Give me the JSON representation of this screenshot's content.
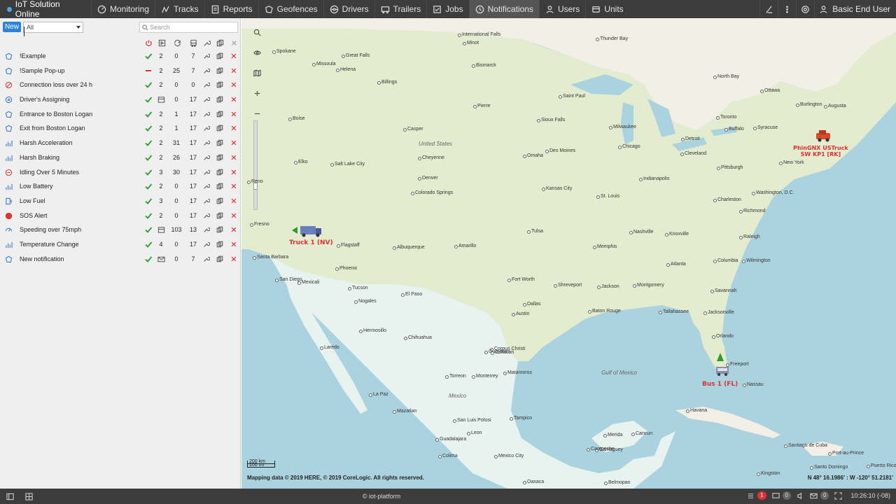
{
  "app": {
    "title": "IoT Solution Online"
  },
  "nav": [
    {
      "label": "Monitoring",
      "icon": "monitoring-icon"
    },
    {
      "label": "Tracks",
      "icon": "tracks-icon"
    },
    {
      "label": "Reports",
      "icon": "reports-icon"
    },
    {
      "label": "Geofences",
      "icon": "geofences-icon"
    },
    {
      "label": "Drivers",
      "icon": "drivers-icon"
    },
    {
      "label": "Trailers",
      "icon": "trailers-icon"
    },
    {
      "label": "Jobs",
      "icon": "jobs-icon"
    },
    {
      "label": "Notifications",
      "icon": "notifications-icon",
      "active": true
    },
    {
      "label": "Users",
      "icon": "users-icon"
    },
    {
      "label": "Units",
      "icon": "units-icon"
    }
  ],
  "user": {
    "name": "Basic End User"
  },
  "panel": {
    "new_label": "New",
    "filter_value": "All",
    "search_placeholder": "Search"
  },
  "notifications": [
    {
      "name": "!Example",
      "status": "on",
      "units": "2",
      "triggered": "0",
      "count": "7",
      "type_icon": "geofence-icon"
    },
    {
      "name": "!Sample Pop-up",
      "status": "off",
      "units": "2",
      "triggered": "25",
      "count": "7",
      "type_icon": "geofence-icon"
    },
    {
      "name": "Connection loss over 24 h",
      "status": "on",
      "units": "2",
      "triggered": "0",
      "count": "0",
      "type_icon": "connection-loss-icon"
    },
    {
      "name": "Driver's Assigning",
      "status": "on",
      "units": "",
      "triggered": "0",
      "count": "17",
      "type_icon": "driver-icon",
      "units_icon": true
    },
    {
      "name": "Entrance to Boston Logan",
      "status": "on",
      "units": "2",
      "triggered": "1",
      "count": "17",
      "type_icon": "geofence-icon"
    },
    {
      "name": "Exit from Boston Logan",
      "status": "on",
      "units": "2",
      "triggered": "1",
      "count": "17",
      "type_icon": "geofence-icon"
    },
    {
      "name": "Harsh Acceleration",
      "status": "on",
      "units": "2",
      "triggered": "31",
      "count": "17",
      "type_icon": "sensor-icon"
    },
    {
      "name": "Harsh Braking",
      "status": "on",
      "units": "2",
      "triggered": "26",
      "count": "17",
      "type_icon": "sensor-icon"
    },
    {
      "name": "Idling Over 5 Minutes",
      "status": "on",
      "units": "3",
      "triggered": "30",
      "count": "17",
      "type_icon": "idling-icon"
    },
    {
      "name": "Low Battery",
      "status": "on",
      "units": "2",
      "triggered": "0",
      "count": "17",
      "type_icon": "sensor-icon"
    },
    {
      "name": "Low Fuel",
      "status": "on",
      "units": "3",
      "triggered": "0",
      "count": "17",
      "type_icon": "fuel-icon"
    },
    {
      "name": "SOS Alert",
      "status": "on",
      "units": "2",
      "triggered": "0",
      "count": "17",
      "type_icon": "sos-icon"
    },
    {
      "name": "Speeding over 75mph",
      "status": "on",
      "units": "",
      "triggered": "103",
      "count": "13",
      "type_icon": "speed-icon",
      "units_icon": true
    },
    {
      "name": "Temperature Change",
      "status": "on",
      "units": "4",
      "triggered": "0",
      "count": "17",
      "type_icon": "sensor-icon"
    },
    {
      "name": "New notification",
      "status": "on",
      "units": "",
      "triggered": "0",
      "count": "7",
      "type_icon": "geofence-icon",
      "mail_icon": true
    }
  ],
  "map": {
    "regions": [
      {
        "label": "United States"
      },
      {
        "label": "Mexico"
      },
      {
        "label": "Gulf of Mexico"
      }
    ],
    "cities": [
      "International Falls",
      "Thunder Bay",
      "Minot",
      "Spokane",
      "Great Falls",
      "Missoula",
      "Helena",
      "Bismarck",
      "Billings",
      "Pierre",
      "Saint Paul",
      "Ottawa",
      "North Bay",
      "Augusta",
      "Burlington",
      "Boise",
      "Casper",
      "Sioux Falls",
      "Milwaukee",
      "Toronto",
      "Buffalo",
      "Syracuse",
      "Detroit",
      "Cleveland",
      "New York",
      "Elko",
      "Salt Lake City",
      "Cheyenne",
      "Des Moines",
      "Chicago",
      "Pittsburgh",
      "Reno",
      "Denver",
      "Omaha",
      "Indianapolis",
      "Washington, D.C.",
      "Colorado Springs",
      "Kansas City",
      "Charleston",
      "Richmond",
      "St. Louis",
      "Fresno",
      "Tulsa",
      "Nashville",
      "Knoxville",
      "Raleigh",
      "Flagstaff",
      "Albuquerque",
      "Amarillo",
      "Memphis",
      "Santa Barbara",
      "Atlanta",
      "Columbia",
      "Wilmington",
      "Phoenix",
      "San Diego",
      "Mexicali",
      "Tucson",
      "Fort Worth",
      "Shreveport",
      "Jackson",
      "Montgomery",
      "Savannah",
      "El Paso",
      "Dallas",
      "Jacksonville",
      "Austin",
      "Baton Rouge",
      "Tallahassee",
      "Nogales",
      "Hermosillo",
      "Chihuahua",
      "Orlando",
      "Freeport",
      "Nassau",
      "Corpus Christi",
      "Guaymas",
      "Laredo",
      "Culiacan",
      "Torreon",
      "Monterrey",
      "Matamoros",
      "La Paz",
      "Havana",
      "Mazatlan",
      "San Luis Potosi",
      "Tampico",
      "Merida",
      "Cancun",
      "Camaguey",
      "Leon",
      "Mexico City",
      "Guadalajara",
      "Colima",
      "Campeche",
      "Kingston",
      "Santiago de Cuba",
      "Port-au-Prince",
      "Santo Domingo",
      "Puerto Rico",
      "Oaxaca",
      "Belmopan"
    ],
    "units": [
      {
        "label": "Truck 1 (NV)"
      },
      {
        "label": "PhinGNX USTruck\nSW KP1 [RK]"
      },
      {
        "label": "Bus 1 (FL)"
      }
    ],
    "scale_km": "200 km",
    "scale_mi": "100 mi",
    "copyright": "Mapping data © 2019 HERE, © 2019 CoreLogic. All rights reserved.",
    "coords": "N 48° 16.1986' : W -120° 51.2181'"
  },
  "footer": {
    "center": "© iot-platform",
    "alerts": "1",
    "notifications_count": "0",
    "messages_count": "0",
    "time": "10:26:10 (-08)"
  },
  "colors": {
    "accent": "#2f83d6",
    "status_on": "#2e9b2e",
    "status_off": "#e02020",
    "delete": "#e02020",
    "unit_label": "#e03030"
  }
}
